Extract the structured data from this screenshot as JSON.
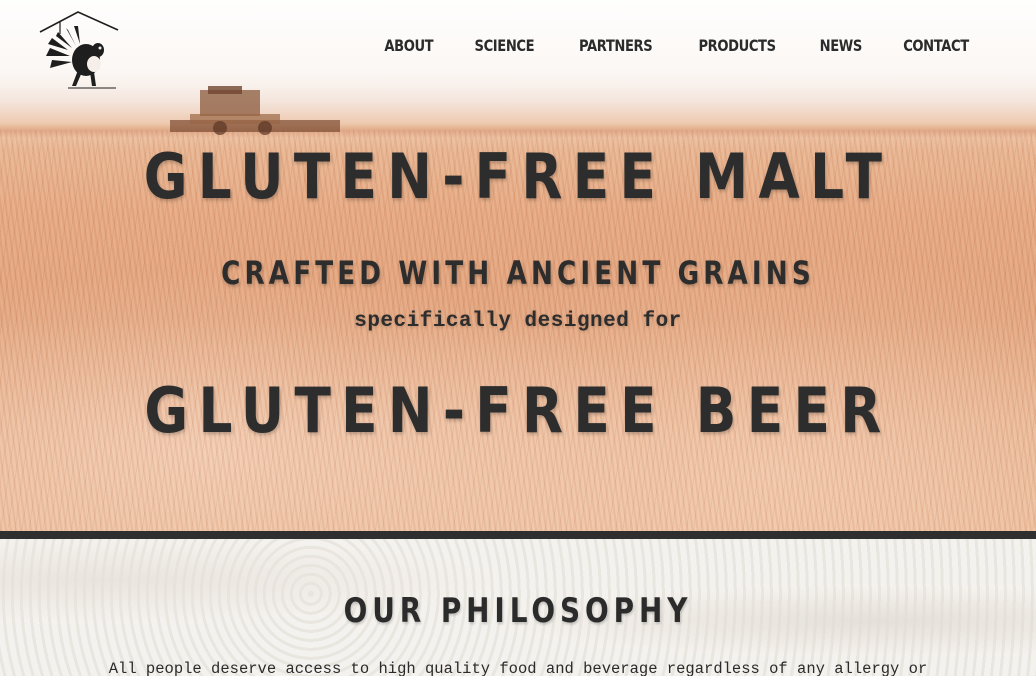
{
  "nav": {
    "items": [
      {
        "label": "ABOUT"
      },
      {
        "label": "SCIENCE"
      },
      {
        "label": "PARTNERS"
      },
      {
        "label": "PRODUCTS"
      },
      {
        "label": "NEWS"
      },
      {
        "label": "CONTACT"
      }
    ]
  },
  "hero": {
    "title": "GLUTEN-FREE MALT",
    "subtitle": "CRAFTED WITH ANCIENT GRAINS",
    "tagline": "specifically designed for",
    "title_secondary": "GLUTEN-FREE BEER"
  },
  "philosophy": {
    "heading": "OUR PHILOSOPHY",
    "text": "All people deserve access to high quality food and beverage regardless of any allergy or"
  },
  "colors": {
    "text_dark": "#2b2b2b",
    "divider": "#2f2f2f",
    "hero_tint": "#e4a67e"
  }
}
